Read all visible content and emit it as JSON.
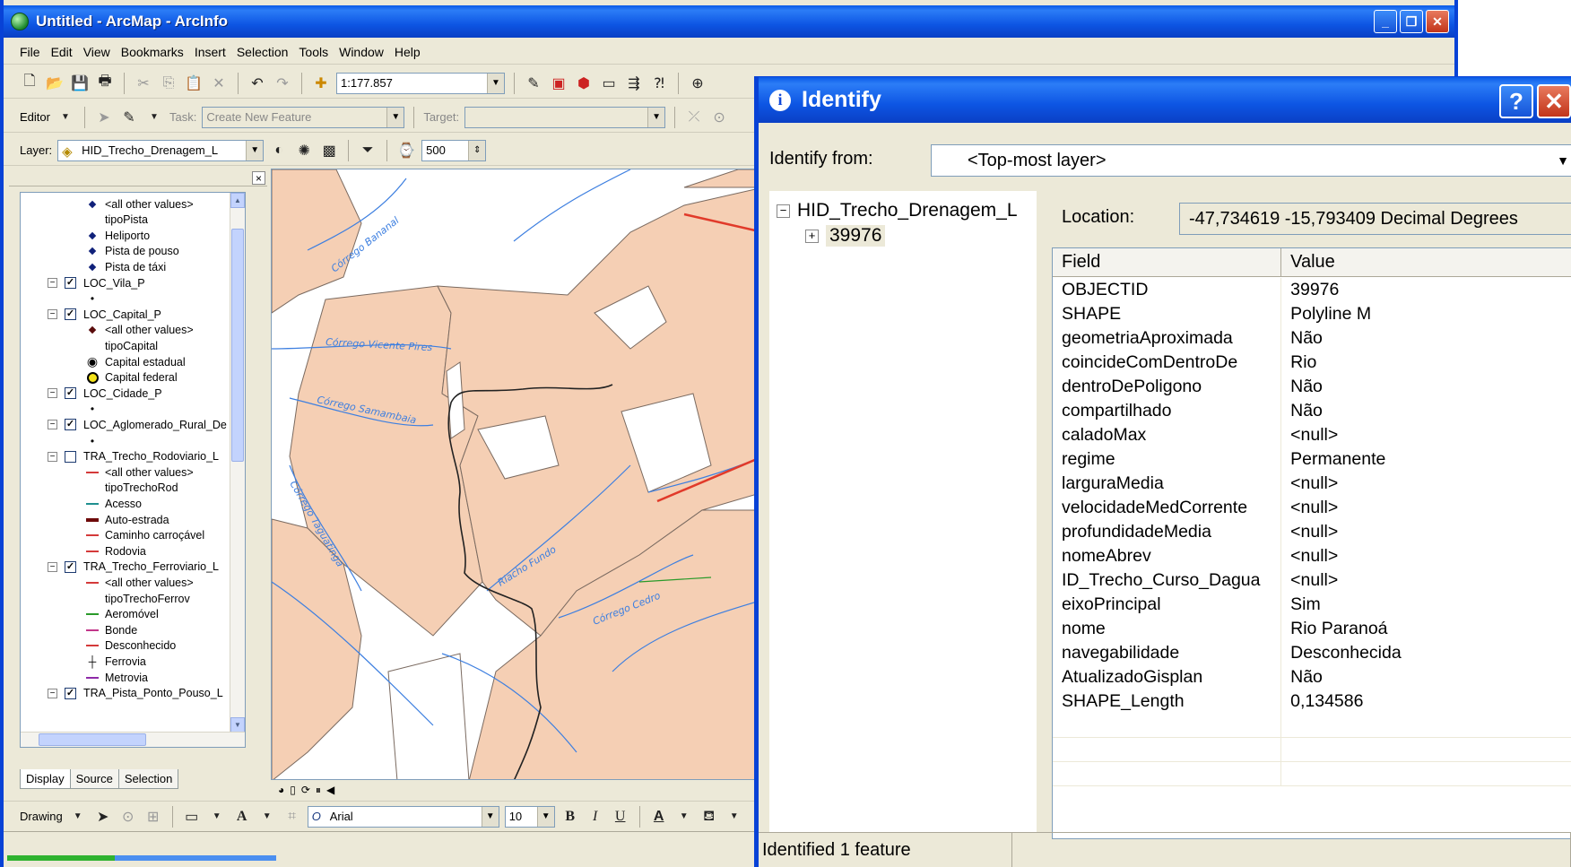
{
  "app": {
    "title": "Untitled - ArcMap - ArcInfo"
  },
  "menu": [
    "File",
    "Edit",
    "View",
    "Bookmarks",
    "Insert",
    "Selection",
    "Tools",
    "Window",
    "Help"
  ],
  "toolbar": {
    "scale": "1:177.857",
    "editor_label": "Editor",
    "task_label": "Task:",
    "task_value": "Create New Feature",
    "target_label": "Target:",
    "target_value": "",
    "layer_label": "Layer:",
    "layer_value": "HID_Trecho_Drenagem_L",
    "snap_value": "500"
  },
  "toc": {
    "rows": [
      {
        "type": "sym",
        "sym": "dot",
        "label": "<all other values>"
      },
      {
        "type": "plain",
        "label": "tipoPista"
      },
      {
        "type": "sym",
        "sym": "dot",
        "label": "Heliporto"
      },
      {
        "type": "sym",
        "sym": "dot",
        "label": "Pista de pouso"
      },
      {
        "type": "sym",
        "sym": "dot",
        "label": "Pista de táxi"
      },
      {
        "type": "layer",
        "checked": true,
        "label": "LOC_Vila_P"
      },
      {
        "type": "sym",
        "sym": "circle-small",
        "label": ""
      },
      {
        "type": "layer",
        "checked": true,
        "label": "LOC_Capital_P"
      },
      {
        "type": "sym",
        "sym": "dot-dark",
        "label": "<all other values>"
      },
      {
        "type": "plain",
        "label": "tipoCapital"
      },
      {
        "type": "sym",
        "sym": "capital-state",
        "label": "Capital estadual"
      },
      {
        "type": "sym",
        "sym": "capital-federal",
        "label": "Capital federal"
      },
      {
        "type": "layer",
        "checked": true,
        "label": "LOC_Cidade_P"
      },
      {
        "type": "sym",
        "sym": "circle-small",
        "label": ""
      },
      {
        "type": "layer",
        "checked": true,
        "label": "LOC_Aglomerado_Rural_De"
      },
      {
        "type": "sym",
        "sym": "circle-small",
        "label": ""
      },
      {
        "type": "layer",
        "checked": false,
        "label": "TRA_Trecho_Rodoviario_L"
      },
      {
        "type": "sym",
        "sym": "line-red",
        "label": "<all other values>"
      },
      {
        "type": "plain",
        "label": "tipoTrechoRod"
      },
      {
        "type": "sym",
        "sym": "line-teal",
        "label": "Acesso"
      },
      {
        "type": "sym",
        "sym": "line-maroon",
        "label": "Auto-estrada"
      },
      {
        "type": "sym",
        "sym": "line-red",
        "label": "Caminho carroçável"
      },
      {
        "type": "sym",
        "sym": "line-red",
        "label": "Rodovia"
      },
      {
        "type": "layer",
        "checked": true,
        "label": "TRA_Trecho_Ferroviario_L"
      },
      {
        "type": "sym",
        "sym": "line-red",
        "label": "<all other values>"
      },
      {
        "type": "plain",
        "label": "tipoTrechoFerrov"
      },
      {
        "type": "sym",
        "sym": "line-green",
        "label": "Aeromóvel"
      },
      {
        "type": "sym",
        "sym": "line-pink",
        "label": "Bonde"
      },
      {
        "type": "sym",
        "sym": "line-red",
        "label": "Desconhecido"
      },
      {
        "type": "sym",
        "sym": "rail",
        "label": "Ferrovia"
      },
      {
        "type": "sym",
        "sym": "line-purple",
        "label": "Metrovia"
      },
      {
        "type": "layer",
        "checked": true,
        "label": "TRA_Pista_Ponto_Pouso_L"
      }
    ],
    "tabs": [
      "Display",
      "Source",
      "Selection"
    ]
  },
  "map": {
    "labels": [
      "Córrego Bananal",
      "Córrego Vicente Pires",
      "Córrego Samambaia",
      "Córrego Taguatinga",
      "Riacho Fundo",
      "Córrego Cedro"
    ]
  },
  "drawbar": {
    "drawing_label": "Drawing",
    "font": "Arial",
    "size": "10"
  },
  "identify": {
    "title": "Identify",
    "from_label": "Identify from:",
    "from_value": "<Top-most layer>",
    "layer_node": "HID_Trecho_Drenagem_L",
    "feature_node": "39976",
    "location_label": "Location:",
    "location_value": "-47,734619  -15,793409 Decimal Degrees",
    "columns": [
      "Field",
      "Value"
    ],
    "rows": [
      [
        "OBJECTID",
        "39976"
      ],
      [
        "SHAPE",
        "Polyline M"
      ],
      [
        "geometriaAproximada",
        "Não"
      ],
      [
        "coincideComDentroDe",
        "Rio"
      ],
      [
        "dentroDePoligono",
        "Não"
      ],
      [
        "compartilhado",
        "Não"
      ],
      [
        "caladoMax",
        "<null>"
      ],
      [
        "regime",
        "Permanente"
      ],
      [
        "larguraMedia",
        "<null>"
      ],
      [
        "velocidadeMedCorrente",
        "<null>"
      ],
      [
        "profundidadeMedia",
        "<null>"
      ],
      [
        "nomeAbrev",
        "<null>"
      ],
      [
        "ID_Trecho_Curso_Dagua",
        "<null>"
      ],
      [
        "eixoPrincipal",
        "Sim"
      ],
      [
        "nome",
        "Rio Paranoá"
      ],
      [
        "navegabilidade",
        "Desconhecida"
      ],
      [
        "AtualizadoGisplan",
        "Não"
      ],
      [
        "SHAPE_Length",
        "0,134586"
      ]
    ],
    "status": "Identified 1 feature"
  },
  "colors": {
    "titlebar": "#0d55e3",
    "land": "#f5cfb4",
    "river": "#3d7fe0",
    "chrome": "#ece9d8"
  }
}
